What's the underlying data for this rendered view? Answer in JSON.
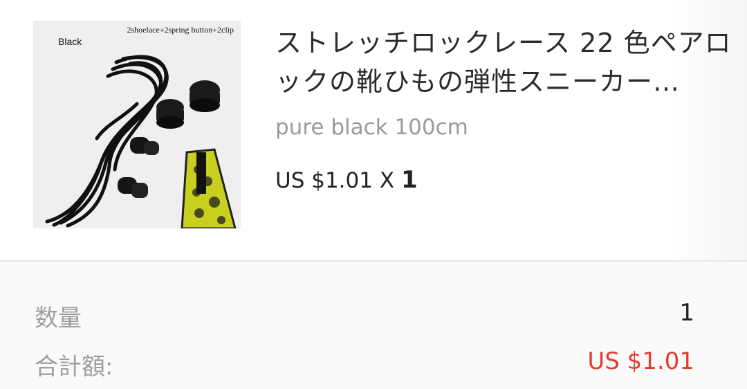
{
  "item": {
    "image_tag": "Black",
    "image_caption": "2shoelace+2spring button+2clip",
    "title": "ストレッチロックレース 22 色ペアロックの靴ひもの弾性スニーカー…",
    "variant": "pure black 100cm",
    "price": "US $1.01",
    "multiplier": "X",
    "quantity": "1"
  },
  "summary": {
    "quantity_label": "数量",
    "quantity_value": "1",
    "total_label": "合計額:",
    "total_value": "US $1.01"
  },
  "colors": {
    "total_price": "#e23b2e",
    "muted_text": "#9e9e9e"
  }
}
